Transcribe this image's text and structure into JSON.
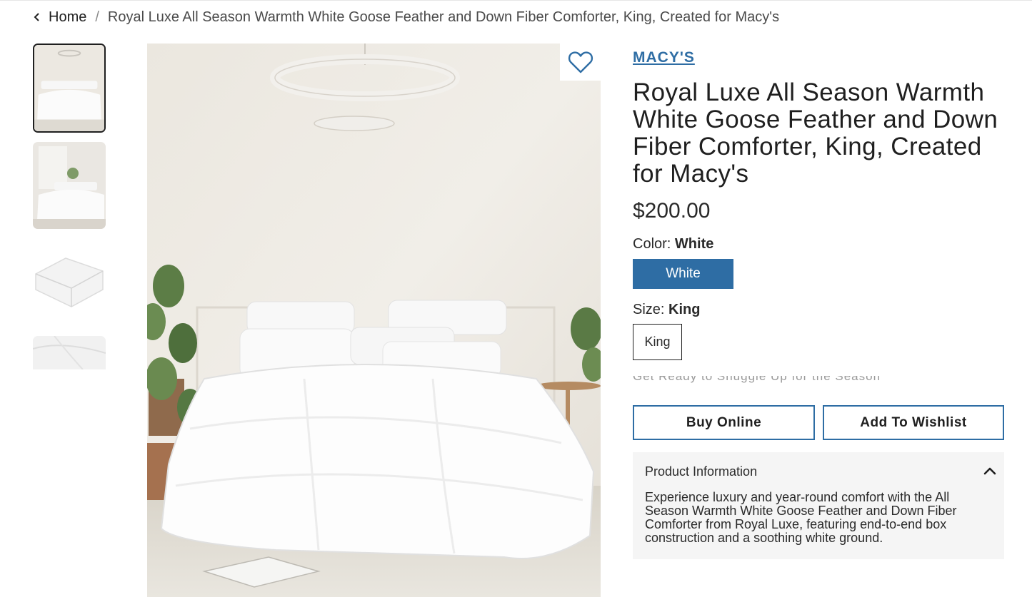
{
  "breadcrumb": {
    "home_label": "Home",
    "separator": "/",
    "current": "Royal Luxe All Season Warmth White Goose Feather and Down Fiber Comforter, King, Created for Macy's"
  },
  "gallery": {
    "thumbnails": [
      {
        "name": "bedroom-overview",
        "active": true
      },
      {
        "name": "bedroom-window",
        "active": false
      },
      {
        "name": "folded-comforter",
        "active": false
      },
      {
        "name": "comforter-detail",
        "active": false
      }
    ],
    "main_image": "bedroom-with-white-comforter",
    "favorite_icon": "heart-icon"
  },
  "product": {
    "brand": "MACY'S",
    "title": "Royal Luxe All Season Warmth White Goose Feather and Down Fiber Comforter, King, Created for Macy's",
    "price": "$200.00",
    "color_label": "Color:",
    "color_value": "White",
    "color_option": "White",
    "size_label": "Size:",
    "size_value": "King",
    "size_option": "King",
    "faded_text": "Get Ready to Snuggle Up for the Season",
    "buy_label": "Buy Online",
    "wishlist_label": "Add To Wishlist"
  },
  "info": {
    "heading": "Product Information",
    "toggle_icon": "chevron-up-icon",
    "description": "Experience luxury and year-round comfort with the All Season Warmth White Goose Feather and Down Fiber Comforter from Royal Luxe, featuring end-to-end box construction and a soothing white ground."
  },
  "colors": {
    "accent": "#2e6da4",
    "text": "#1f1f1f",
    "panel_bg": "#f5f5f5"
  }
}
